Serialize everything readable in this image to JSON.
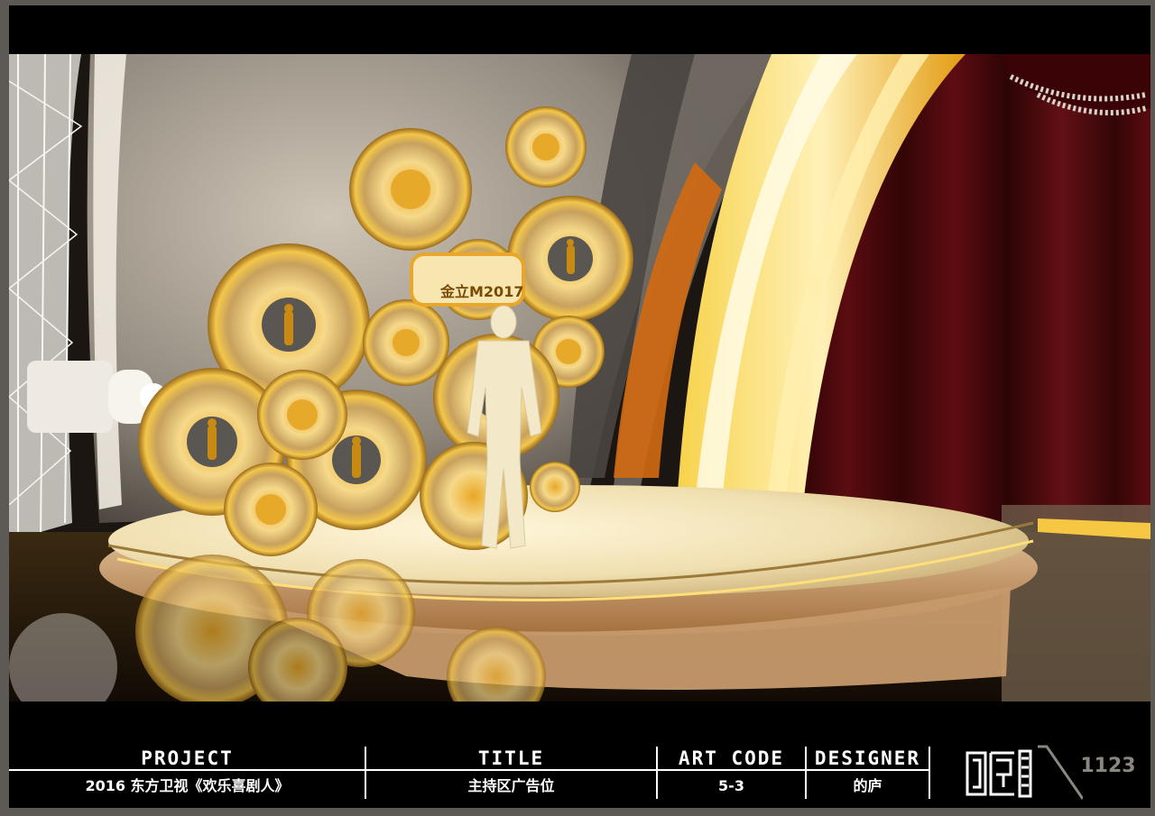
{
  "scene": {
    "stage_sign_text": "金立M2017",
    "colors": {
      "gold": "#f2c23a",
      "gold_dark": "#b8860b",
      "curtain": "#4a0a0e",
      "floor": "#f3e6c4",
      "backdrop": "#9e958a"
    }
  },
  "titleblock": {
    "project_label": "PROJECT",
    "project_value": "2016 东方卫视《欢乐喜剧人》",
    "title_label": "TITLE",
    "title_value": "主持区广告位",
    "art_code_label": "ART CODE",
    "art_code_value": "5-3",
    "designer_label": "DESIGNER",
    "designer_value": "的庐",
    "logo_icon": "studio-logo-icon",
    "sheet_number": "1123"
  }
}
